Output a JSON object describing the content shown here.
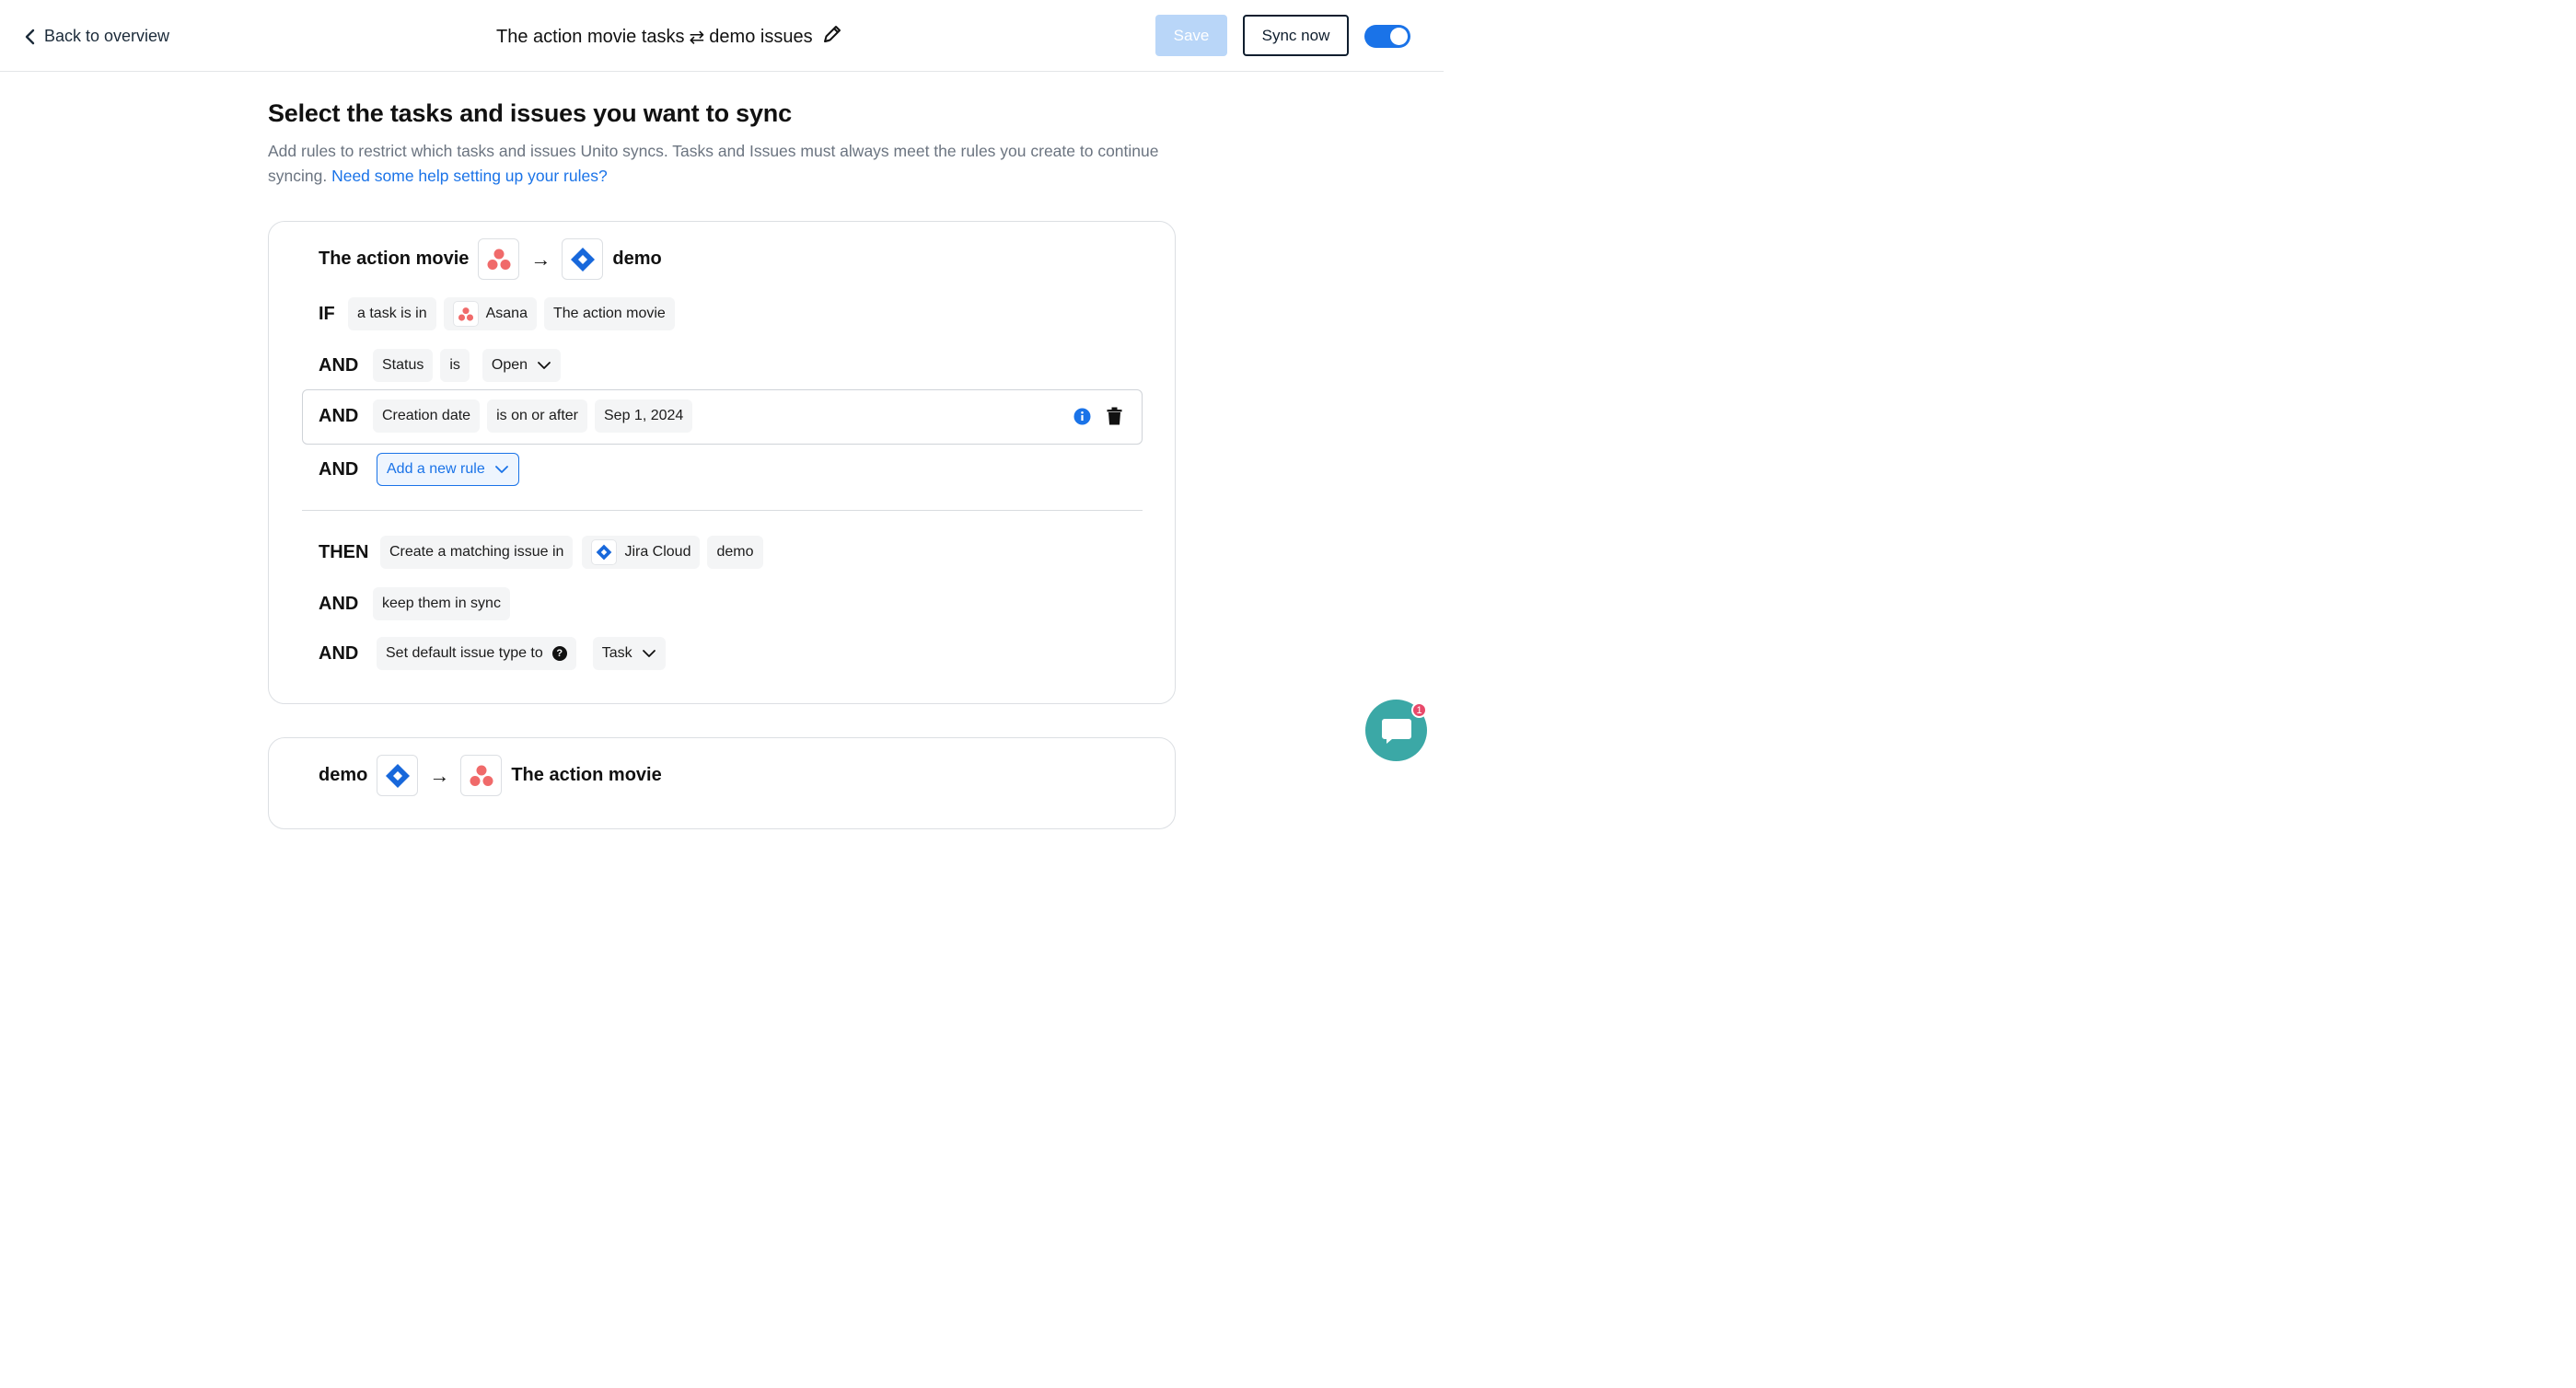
{
  "header": {
    "back_label": "Back to overview",
    "title_left": "The action movie tasks",
    "title_swap": "⇄",
    "title_right": "demo issues",
    "save_label": "Save",
    "sync_label": "Sync now"
  },
  "main": {
    "heading": "Select the tasks and issues you want to sync",
    "description": "Add rules to restrict which tasks and issues Unito syncs. Tasks and Issues must always meet the rules you create to continue syncing.",
    "help_link": "Need some help setting up your rules?"
  },
  "card1": {
    "source": "The action movie",
    "arrow": "→",
    "target": "demo",
    "if_kw": "IF",
    "if_chips": [
      "a task is in",
      "Asana",
      "The action movie"
    ],
    "and_kw": "AND",
    "status_chips": [
      "Status",
      "is",
      "Open"
    ],
    "date_chips": [
      "Creation date",
      "is on or after",
      "Sep 1, 2024"
    ],
    "add_rule_label": "Add a new rule",
    "then_kw": "THEN",
    "then_chips": [
      "Create a matching issue in",
      "Jira Cloud",
      "demo"
    ],
    "keep_chip": "keep them in sync",
    "default_type_label": "Set default issue type to",
    "default_type_value": "Task"
  },
  "card2": {
    "source": "demo",
    "arrow": "→",
    "target": "The action movie"
  },
  "chat": {
    "badge": "1"
  },
  "colors": {
    "accent": "#1a73e8",
    "asana": "#f06a6a",
    "jira": "#1868db",
    "chat": "#3ba8a6",
    "badge": "#e8496a"
  }
}
